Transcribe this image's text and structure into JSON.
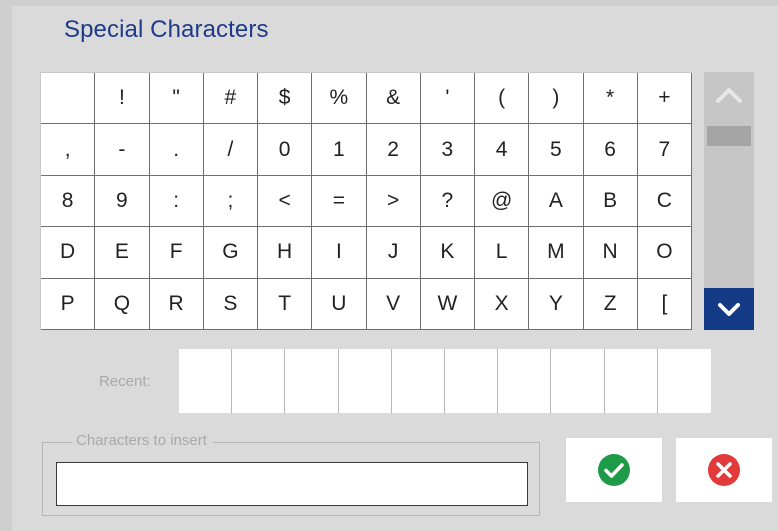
{
  "dialog": {
    "title": "Special Characters"
  },
  "grid": {
    "rows": [
      [
        "",
        "!",
        "\"",
        "#",
        "$",
        "%",
        "&",
        "'",
        "(",
        ")",
        "*",
        "+"
      ],
      [
        ",",
        "-",
        ".",
        "/",
        "0",
        "1",
        "2",
        "3",
        "4",
        "5",
        "6",
        "7"
      ],
      [
        "8",
        "9",
        ":",
        ";",
        "<",
        "=",
        ">",
        "?",
        "@",
        "A",
        "B",
        "C"
      ],
      [
        "D",
        "E",
        "F",
        "G",
        "H",
        "I",
        "J",
        "K",
        "L",
        "M",
        "N",
        "O"
      ],
      [
        "P",
        "Q",
        "R",
        "S",
        "T",
        "U",
        "V",
        "W",
        "X",
        "Y",
        "Z",
        "["
      ]
    ]
  },
  "scrollbar": {
    "up_icon": "chevron-up-icon",
    "down_icon": "chevron-down-icon",
    "down_button_color": "#143a85"
  },
  "recent": {
    "label": "Recent:",
    "slots": [
      "",
      "",
      "",
      "",
      "",
      "",
      "",
      "",
      "",
      ""
    ]
  },
  "insert": {
    "legend": "Characters to insert",
    "value": "",
    "placeholder": ""
  },
  "actions": {
    "ok_icon": "checkmark-icon",
    "ok_color": "#1e9b48",
    "cancel_icon": "close-icon",
    "cancel_color": "#e23a3a"
  },
  "title_color": "#1d3b8a"
}
